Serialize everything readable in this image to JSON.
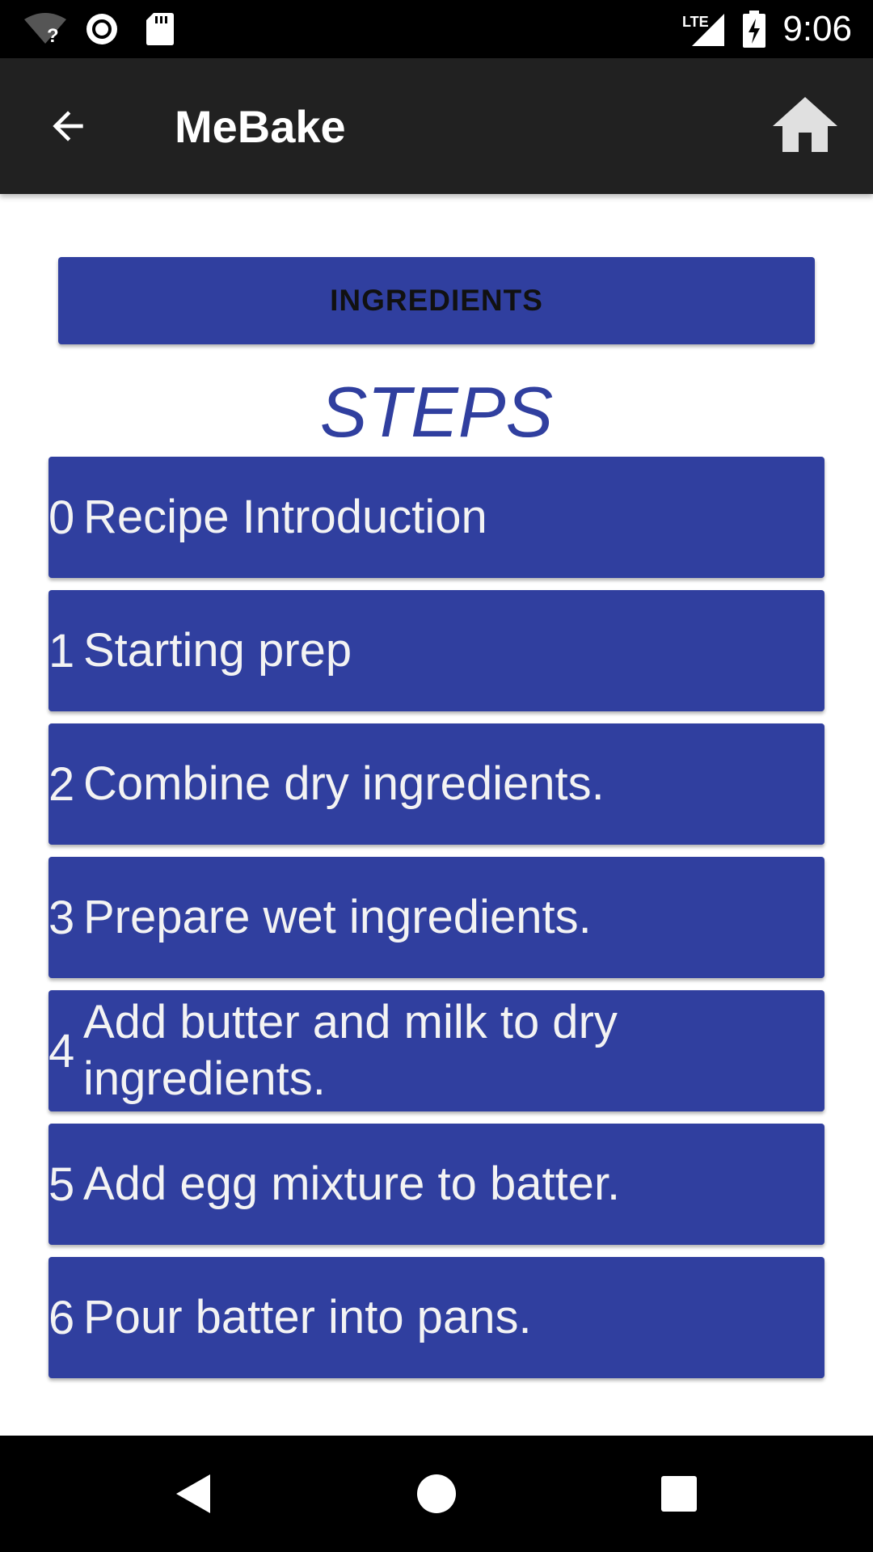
{
  "status_bar": {
    "time": "9:06",
    "network_label": "LTE",
    "icons": [
      "wifi-unknown-icon",
      "record-icon",
      "sd-card-icon",
      "lte-signal-icon",
      "battery-charging-icon"
    ]
  },
  "app_bar": {
    "title": "MeBake",
    "back_icon": "arrow-left-icon",
    "home_icon": "home-icon"
  },
  "content": {
    "ingredients_label": "INGREDIENTS",
    "steps_heading": "STEPS",
    "steps": [
      {
        "number": "0",
        "title": "Recipe Introduction"
      },
      {
        "number": "1",
        "title": "Starting prep"
      },
      {
        "number": "2",
        "title": "Combine dry ingredients."
      },
      {
        "number": "3",
        "title": "Prepare wet ingredients."
      },
      {
        "number": "4",
        "title": "Add butter and milk to dry ingredients."
      },
      {
        "number": "5",
        "title": "Add egg mixture to batter."
      },
      {
        "number": "6",
        "title": "Pour batter into pans."
      }
    ]
  },
  "nav_bar": {
    "icons": [
      "nav-back-icon",
      "nav-home-icon",
      "nav-recents-icon"
    ]
  },
  "colors": {
    "primary": "#303f9f",
    "app_bar": "#212121",
    "status_bar": "#000000",
    "background": "#ffffff",
    "step_text": "#f3f3f3"
  }
}
